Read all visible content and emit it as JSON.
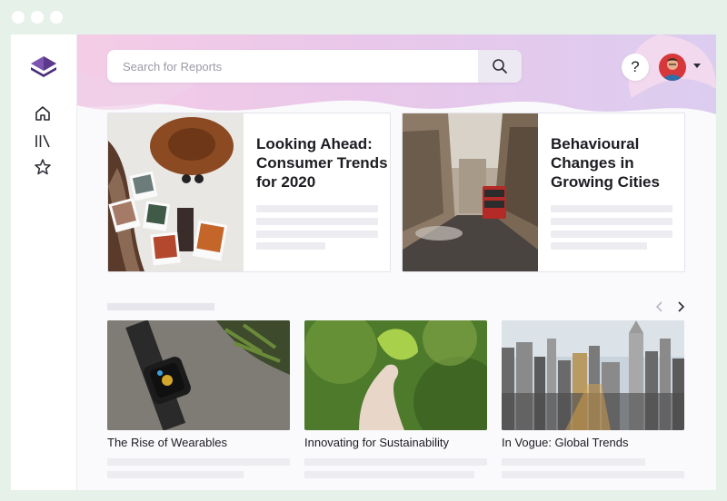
{
  "window_controls": [
    "dot",
    "dot",
    "dot"
  ],
  "sidebar": {
    "logo": "layers-logo",
    "items": [
      {
        "name": "home",
        "icon": "home-icon"
      },
      {
        "name": "library",
        "icon": "library-icon"
      },
      {
        "name": "favorites",
        "icon": "star-icon"
      }
    ]
  },
  "header": {
    "search_placeholder": "Search for Reports",
    "search_icon": "search-icon",
    "help_label": "?",
    "avatar": "user-avatar",
    "menu_icon": "caret-down-icon"
  },
  "featured": [
    {
      "title": "Looking Ahead: Consumer Trends for 2020",
      "image": "hat-and-photos"
    },
    {
      "title": "Behavioural Changes in Growing Cities",
      "image": "city-street-bus"
    }
  ],
  "carousel": {
    "prev_icon": "chevron-left-icon",
    "next_icon": "chevron-right-icon",
    "items": [
      {
        "title": "The Rise of Wearables",
        "image": "smartwatch"
      },
      {
        "title": "Innovating for Sustainability",
        "image": "hand-with-leaf"
      },
      {
        "title": "In Vogue: Global Trends",
        "image": "city-skyline"
      }
    ]
  },
  "colors": {
    "frame": "#e6f1e9",
    "header_gradient": [
      "#f0c4e2",
      "#dcc8ee"
    ],
    "logo": "#5b3a8c",
    "text": "#1c1c22",
    "placeholder_bar": "#ececf1"
  }
}
